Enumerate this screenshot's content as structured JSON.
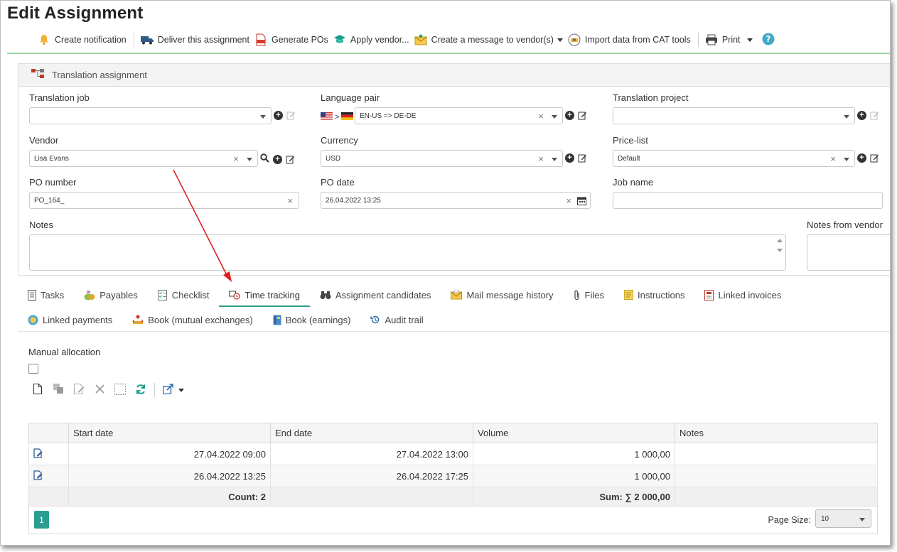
{
  "page": {
    "title": "Edit Assignment"
  },
  "toolbar": {
    "create_notification": "Create notification",
    "deliver": "Deliver this assignment",
    "generate_pos": "Generate POs",
    "apply_vendor": "Apply vendor...",
    "create_message": "Create a message to vendor(s)",
    "import_cat": "Import data from CAT tools",
    "print": "Print"
  },
  "panel": {
    "title": "Translation assignment"
  },
  "form": {
    "translation_job": {
      "label": "Translation job",
      "value": ""
    },
    "language_pair": {
      "label": "Language pair",
      "value": "EN-US => DE-DE",
      "separator": ">"
    },
    "translation_project": {
      "label": "Translation project",
      "value": ""
    },
    "vendor": {
      "label": "Vendor",
      "value": "Lisa Evans"
    },
    "currency": {
      "label": "Currency",
      "value": "USD"
    },
    "price_list": {
      "label": "Price-list",
      "value": "Default"
    },
    "po_number": {
      "label": "PO number",
      "value": "PO_164_"
    },
    "po_date": {
      "label": "PO date",
      "value": "26.04.2022 13:25"
    },
    "job_name": {
      "label": "Job name",
      "value": ""
    },
    "notes": {
      "label": "Notes",
      "value": ""
    },
    "notes_from_vendor": {
      "label": "Notes from vendor",
      "value": ""
    }
  },
  "tabs": {
    "row1": [
      "Tasks",
      "Payables",
      "Checklist",
      "Time tracking",
      "Assignment candidates",
      "Mail message history",
      "Files",
      "Instructions",
      "Linked invoices"
    ],
    "row2": [
      "Linked payments",
      "Book (mutual exchanges)",
      "Book (earnings)",
      "Audit trail"
    ],
    "active": "Time tracking"
  },
  "time_tracking": {
    "manual_allocation_label": "Manual allocation",
    "manual_allocation_checked": false,
    "columns": [
      "Start date",
      "End date",
      "Volume",
      "Notes"
    ],
    "rows": [
      {
        "start": "27.04.2022 09:00",
        "end": "27.04.2022 13:00",
        "volume": "1 000,00",
        "notes": ""
      },
      {
        "start": "26.04.2022 13:25",
        "end": "26.04.2022 17:25",
        "volume": "1 000,00",
        "notes": ""
      }
    ],
    "footer": {
      "count": "Count: 2",
      "sum": "Sum: ∑ 2 000,00"
    }
  },
  "pager": {
    "current_page": "1",
    "page_size_label": "Page Size:",
    "page_size": "10"
  },
  "colors": {
    "accent": "#2a9d8f",
    "annotation_arrow": "#e02020",
    "divider_green": "#9fd7a6"
  }
}
